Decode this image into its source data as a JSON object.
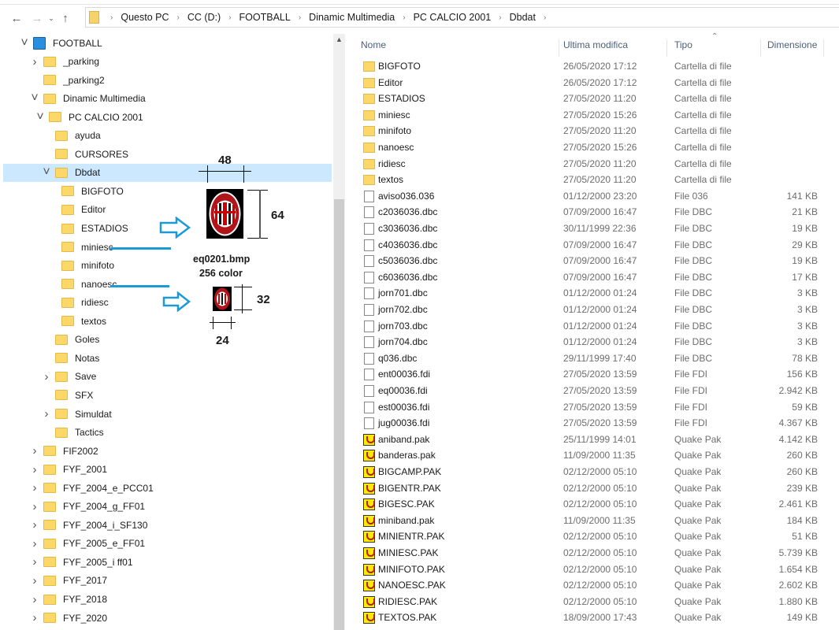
{
  "nav": {
    "back_icon": "arrow-left-icon",
    "forward_icon": "arrow-right-icon",
    "recent_icon": "chevron-down-icon",
    "up_icon": "arrow-up-icon"
  },
  "breadcrumb": [
    "Questo PC",
    "CC (D:)",
    "FOOTBALL",
    "Dinamic Multimedia",
    "PC CALCIO 2001",
    "Dbdat"
  ],
  "tree": [
    {
      "label": "FOOTBALL",
      "level": 0,
      "state": "expanded",
      "icon": "app-icon"
    },
    {
      "label": "_parking",
      "level": 1,
      "state": "collapsed"
    },
    {
      "label": "_parking2",
      "level": 1,
      "state": "none"
    },
    {
      "label": "Dinamic Multimedia",
      "level": 1,
      "state": "expanded"
    },
    {
      "label": "PC CALCIO 2001",
      "level": 2,
      "state": "expanded"
    },
    {
      "label": "ayuda",
      "level": 3,
      "state": "none"
    },
    {
      "label": "CURSORES",
      "level": 3,
      "state": "none"
    },
    {
      "label": "Dbdat",
      "level": 3,
      "state": "expanded",
      "selected": true
    },
    {
      "label": "BIGFOTO",
      "level": 4,
      "state": "none"
    },
    {
      "label": "Editor",
      "level": 4,
      "state": "none"
    },
    {
      "label": "ESTADIOS",
      "level": 4,
      "state": "none"
    },
    {
      "label": "miniesc",
      "level": 4,
      "state": "none"
    },
    {
      "label": "minifoto",
      "level": 4,
      "state": "none"
    },
    {
      "label": "nanoesc",
      "level": 4,
      "state": "none"
    },
    {
      "label": "ridiesc",
      "level": 4,
      "state": "none"
    },
    {
      "label": "textos",
      "level": 4,
      "state": "none"
    },
    {
      "label": "Goles",
      "level": 3,
      "state": "none"
    },
    {
      "label": "Notas",
      "level": 3,
      "state": "none"
    },
    {
      "label": "Save",
      "level": 3,
      "state": "collapsed"
    },
    {
      "label": "SFX",
      "level": 3,
      "state": "none"
    },
    {
      "label": "Simuldat",
      "level": 3,
      "state": "collapsed"
    },
    {
      "label": "Tactics",
      "level": 3,
      "state": "none"
    },
    {
      "label": "FIF2002",
      "level": 1,
      "state": "collapsed"
    },
    {
      "label": "FYF_2001",
      "level": 1,
      "state": "collapsed"
    },
    {
      "label": "FYF_2004_e_PCC01",
      "level": 1,
      "state": "collapsed"
    },
    {
      "label": "FYF_2004_g_FF01",
      "level": 1,
      "state": "collapsed"
    },
    {
      "label": "FYF_2004_i_SF130",
      "level": 1,
      "state": "collapsed"
    },
    {
      "label": "FYF_2005_e_FF01",
      "level": 1,
      "state": "collapsed"
    },
    {
      "label": "FYF_2005_i ff01",
      "level": 1,
      "state": "collapsed"
    },
    {
      "label": "FYF_2017",
      "level": 1,
      "state": "collapsed"
    },
    {
      "label": "FYF_2018",
      "level": 1,
      "state": "collapsed"
    },
    {
      "label": "FYF_2020",
      "level": 1,
      "state": "collapsed"
    }
  ],
  "columns": {
    "name": "Nome",
    "modified": "Ultima modifica",
    "type": "Tipo",
    "size": "Dimensione",
    "sorted": "Tipo"
  },
  "files": [
    {
      "name": "BIGFOTO",
      "date": "26/05/2020 17:12",
      "type": "Cartella di file",
      "size": "",
      "icon": "folder"
    },
    {
      "name": "Editor",
      "date": "26/05/2020 17:12",
      "type": "Cartella di file",
      "size": "",
      "icon": "folder"
    },
    {
      "name": "ESTADIOS",
      "date": "27/05/2020 11:20",
      "type": "Cartella di file",
      "size": "",
      "icon": "folder"
    },
    {
      "name": "miniesc",
      "date": "27/05/2020 15:26",
      "type": "Cartella di file",
      "size": "",
      "icon": "folder"
    },
    {
      "name": "minifoto",
      "date": "27/05/2020 11:20",
      "type": "Cartella di file",
      "size": "",
      "icon": "folder"
    },
    {
      "name": "nanoesc",
      "date": "27/05/2020 15:26",
      "type": "Cartella di file",
      "size": "",
      "icon": "folder"
    },
    {
      "name": "ridiesc",
      "date": "27/05/2020 11:20",
      "type": "Cartella di file",
      "size": "",
      "icon": "folder"
    },
    {
      "name": "textos",
      "date": "27/05/2020 11:20",
      "type": "Cartella di file",
      "size": "",
      "icon": "folder"
    },
    {
      "name": "aviso036.036",
      "date": "01/12/2000 23:20",
      "type": "File 036",
      "size": "141 KB",
      "icon": "file"
    },
    {
      "name": "c2036036.dbc",
      "date": "07/09/2000 16:47",
      "type": "File DBC",
      "size": "21 KB",
      "icon": "file"
    },
    {
      "name": "c3036036.dbc",
      "date": "30/11/1999 22:36",
      "type": "File DBC",
      "size": "19 KB",
      "icon": "file"
    },
    {
      "name": "c4036036.dbc",
      "date": "07/09/2000 16:47",
      "type": "File DBC",
      "size": "29 KB",
      "icon": "file"
    },
    {
      "name": "c5036036.dbc",
      "date": "07/09/2000 16:47",
      "type": "File DBC",
      "size": "19 KB",
      "icon": "file"
    },
    {
      "name": "c6036036.dbc",
      "date": "07/09/2000 16:47",
      "type": "File DBC",
      "size": "17 KB",
      "icon": "file"
    },
    {
      "name": "jorn701.dbc",
      "date": "01/12/2000 01:24",
      "type": "File DBC",
      "size": "3 KB",
      "icon": "file"
    },
    {
      "name": "jorn702.dbc",
      "date": "01/12/2000 01:24",
      "type": "File DBC",
      "size": "3 KB",
      "icon": "file"
    },
    {
      "name": "jorn703.dbc",
      "date": "01/12/2000 01:24",
      "type": "File DBC",
      "size": "3 KB",
      "icon": "file"
    },
    {
      "name": "jorn704.dbc",
      "date": "01/12/2000 01:24",
      "type": "File DBC",
      "size": "3 KB",
      "icon": "file"
    },
    {
      "name": "q036.dbc",
      "date": "29/11/1999 17:40",
      "type": "File DBC",
      "size": "78 KB",
      "icon": "file"
    },
    {
      "name": "ent00036.fdi",
      "date": "27/05/2020 13:59",
      "type": "File FDI",
      "size": "156 KB",
      "icon": "file"
    },
    {
      "name": "eq00036.fdi",
      "date": "27/05/2020 13:59",
      "type": "File FDI",
      "size": "2.942 KB",
      "icon": "file"
    },
    {
      "name": "est00036.fdi",
      "date": "27/05/2020 13:59",
      "type": "File FDI",
      "size": "59 KB",
      "icon": "file"
    },
    {
      "name": "jug00036.fdi",
      "date": "27/05/2020 13:59",
      "type": "File FDI",
      "size": "4.367 KB",
      "icon": "file"
    },
    {
      "name": "aniband.pak",
      "date": "25/11/1999 14:01",
      "type": "Quake Pak",
      "size": "4.142 KB",
      "icon": "pak"
    },
    {
      "name": "banderas.pak",
      "date": "11/09/2000 11:35",
      "type": "Quake Pak",
      "size": "260 KB",
      "icon": "pak"
    },
    {
      "name": "BIGCAMP.PAK",
      "date": "02/12/2000 05:10",
      "type": "Quake Pak",
      "size": "260 KB",
      "icon": "pak"
    },
    {
      "name": "BIGENTR.PAK",
      "date": "02/12/2000 05:10",
      "type": "Quake Pak",
      "size": "239 KB",
      "icon": "pak"
    },
    {
      "name": "BIGESC.PAK",
      "date": "02/12/2000 05:10",
      "type": "Quake Pak",
      "size": "2.461 KB",
      "icon": "pak"
    },
    {
      "name": "miniband.pak",
      "date": "11/09/2000 11:35",
      "type": "Quake Pak",
      "size": "184 KB",
      "icon": "pak"
    },
    {
      "name": "MINIENTR.PAK",
      "date": "02/12/2000 05:10",
      "type": "Quake Pak",
      "size": "51 KB",
      "icon": "pak"
    },
    {
      "name": "MINIESC.PAK",
      "date": "02/12/2000 05:10",
      "type": "Quake Pak",
      "size": "5.739 KB",
      "icon": "pak"
    },
    {
      "name": "MINIFOTO.PAK",
      "date": "02/12/2000 05:10",
      "type": "Quake Pak",
      "size": "1.654 KB",
      "icon": "pak"
    },
    {
      "name": "NANOESC.PAK",
      "date": "02/12/2000 05:10",
      "type": "Quake Pak",
      "size": "2.602 KB",
      "icon": "pak"
    },
    {
      "name": "RIDIESC.PAK",
      "date": "02/12/2000 05:10",
      "type": "Quake Pak",
      "size": "1.880 KB",
      "icon": "pak"
    },
    {
      "name": "TEXTOS.PAK",
      "date": "18/09/2000 17:43",
      "type": "Quake Pak",
      "size": "149 KB",
      "icon": "pak"
    }
  ],
  "annotation": {
    "width_big": "48",
    "height_big": "64",
    "filename": "eq0201.bmp",
    "colors": "256 color",
    "height_small": "32",
    "width_small": "24",
    "accent": "#1a9ad6",
    "logo_text": "ACM 1899"
  }
}
